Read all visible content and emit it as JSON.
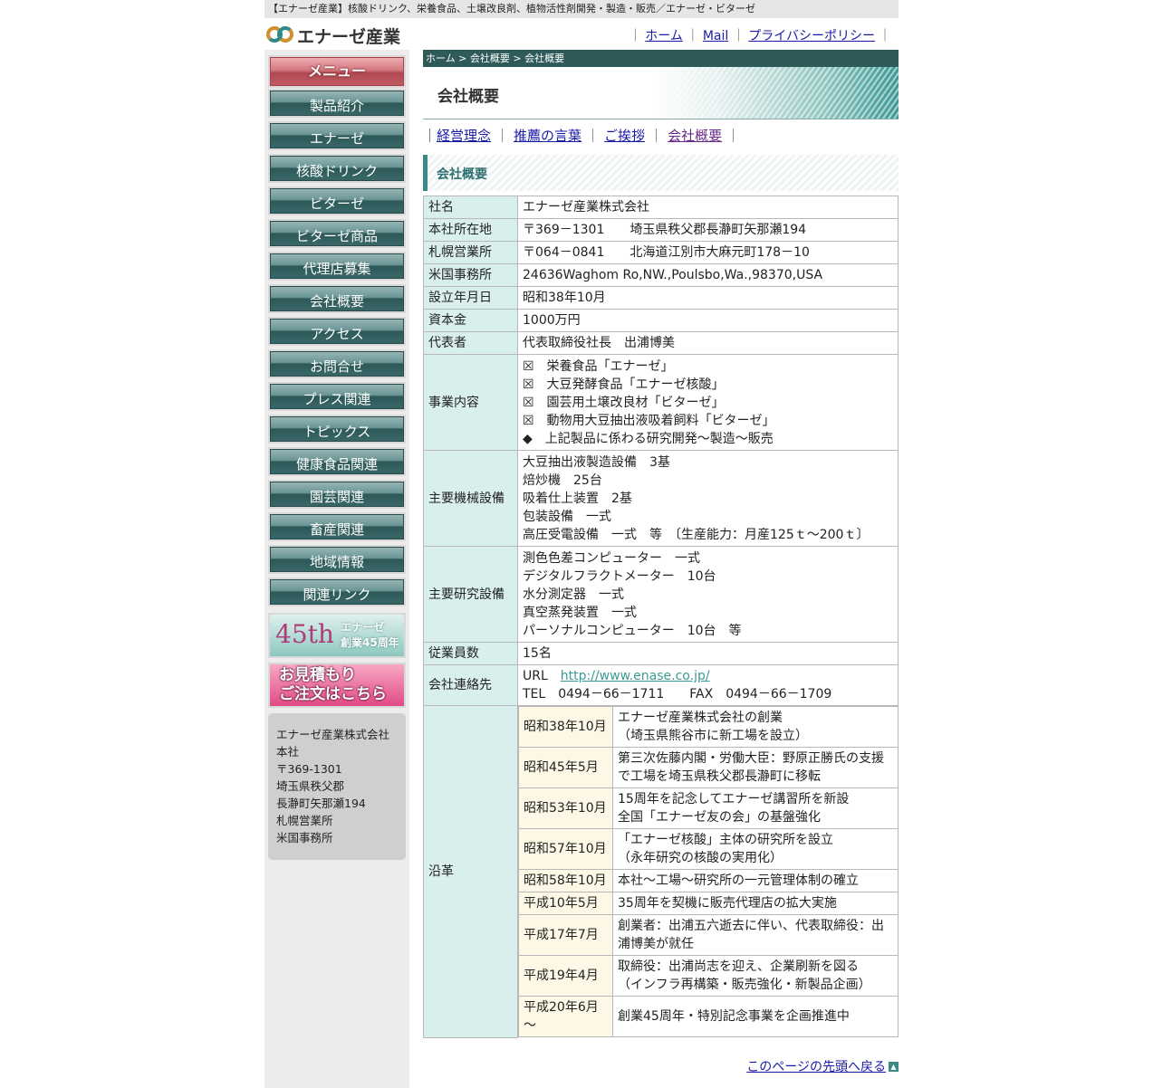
{
  "topbar": {
    "text": "【エナーゼ産業】核酸ドリンク、栄養食品、土壌改良剤、植物活性剤開発・製造・販売／エナーゼ・ビターゼ"
  },
  "header": {
    "logo_text": "エナーゼ産業",
    "nav": [
      {
        "label": "ホーム"
      },
      {
        "label": "Mail"
      },
      {
        "label": "プライバシーポリシー"
      }
    ],
    "separator": "｜"
  },
  "sidebar": {
    "menu_label": "メニュー",
    "items": [
      {
        "label": "製品紹介"
      },
      {
        "label": "エナーゼ"
      },
      {
        "label": "核酸ドリンク"
      },
      {
        "label": "ビターゼ"
      },
      {
        "label": "ビターゼ商品"
      },
      {
        "label": "代理店募集"
      },
      {
        "label": "会社概要"
      },
      {
        "label": "アクセス"
      },
      {
        "label": "お問合せ"
      },
      {
        "label": "プレス関連"
      },
      {
        "label": "トピックス"
      },
      {
        "label": "健康食品関連"
      },
      {
        "label": "園芸関連"
      },
      {
        "label": "畜産関連"
      },
      {
        "label": "地域情報"
      },
      {
        "label": "関連リンク"
      }
    ],
    "banner_45": {
      "big": "45th",
      "line1": "エナーゼ",
      "line2": "創業45周年"
    },
    "banner_order": {
      "line1": "お見積もり",
      "line2": "ご注文はこちら"
    },
    "address": [
      "エナーゼ産業株式会社",
      "本社",
      "〒369-1301",
      "埼玉県秩父郡",
      "長瀞町矢那瀬194",
      "札幌営業所",
      "米国事務所"
    ]
  },
  "main": {
    "breadcrumb": "ホーム > 会社概要 > 会社概要",
    "page_title": "会社概要",
    "subnav": [
      {
        "label": "経営理念"
      },
      {
        "label": "推薦の言葉"
      },
      {
        "label": "ご挨拶"
      },
      {
        "label": "会社概要"
      }
    ],
    "section_title": "会社概要",
    "rows": {
      "name": {
        "label": "社名",
        "value": "エナーゼ産業株式会社"
      },
      "hq": {
        "label": "本社所在地",
        "value": "〒369－1301　　埼玉県秩父郡長瀞町矢那瀬194"
      },
      "sapporo": {
        "label": "札幌営業所",
        "value": "〒064－0841　　北海道江別市大麻元町178－10"
      },
      "us": {
        "label": "米国事務所",
        "value": "24636Waghom Ro,NW.,Poulsbo,Wa.,98370,USA"
      },
      "founded": {
        "label": "設立年月日",
        "value": "昭和38年10月"
      },
      "capital": {
        "label": "資本金",
        "value": "1000万円"
      },
      "rep": {
        "label": "代表者",
        "value": "代表取締役社長　出浦博美"
      },
      "business": {
        "label": "事業内容",
        "lines": [
          "☒　栄養食品「エナーゼ」",
          "☒　大豆発酵食品「エナーゼ核酸」",
          "☒　園芸用土壌改良材「ビターゼ」",
          "☒　動物用大豆抽出液吸着飼料「ビターゼ」",
          "◆　上記製品に係わる研究開発～製造～販売"
        ]
      },
      "machines": {
        "label": "主要機械設備",
        "lines": [
          "大豆抽出液製造設備　3基",
          "焙炒機　25台",
          "吸着仕上装置　2基",
          "包装設備　一式",
          "高圧受電設備　一式　等　〔生産能力：月産125ｔ～200ｔ〕"
        ]
      },
      "research": {
        "label": "主要研究設備",
        "lines": [
          "測色色差コンピューター　一式",
          "デジタルフラクトメーター　10台",
          "水分測定器　一式",
          "真空蒸発装置　一式",
          "パーソナルコンピューター　10台　等"
        ]
      },
      "employees": {
        "label": "従業員数",
        "value": "15名"
      },
      "contact": {
        "label": "会社連絡先",
        "url_label": "URL　",
        "url": "http://www.enase.co.jp/",
        "tel": "TEL　0494－66－1711　　FAX　0494－66－1709"
      },
      "history": {
        "label": "沿革",
        "items": [
          {
            "date": "昭和38年10月",
            "lines": [
              "エナーゼ産業株式会社の創業",
              "（埼玉県熊谷市に新工場を設立）"
            ]
          },
          {
            "date": "昭和45年5月",
            "lines": [
              "第三次佐藤内閣・労働大臣：野原正勝氏の支援",
              "で工場を埼玉県秩父郡長瀞町に移転"
            ]
          },
          {
            "date": "昭和53年10月",
            "lines": [
              "15周年を記念してエナーゼ講習所を新設",
              "全国「エナーゼ友の会」の基盤強化"
            ]
          },
          {
            "date": "昭和57年10月",
            "lines": [
              "「エナーゼ核酸」主体の研究所を設立",
              "（永年研究の核酸の実用化）"
            ]
          },
          {
            "date": "昭和58年10月",
            "lines": [
              "本社～工場～研究所の一元管理体制の確立"
            ]
          },
          {
            "date": "平成10年5月",
            "lines": [
              "35周年を契機に販売代理店の拡大実施"
            ]
          },
          {
            "date": "平成17年7月",
            "lines": [
              "創業者：出浦五六逝去に伴い、代表取締役：出",
              "浦博美が就任"
            ]
          },
          {
            "date": "平成19年4月",
            "lines": [
              "取締役：出浦尚志を迎え、企業刷新を図る",
              "（インフラ再構築・販売強化・新製品企画）"
            ]
          },
          {
            "date": "平成20年6月～",
            "lines": [
              "創業45周年・特別記念事業を企画推進中"
            ]
          }
        ]
      }
    },
    "back_to_top": "このページの先頭へ戻る"
  },
  "colors": {
    "teal_dark": "#2e5a5a",
    "teal_accent": "#3a8a86",
    "label_bg": "#d8efee",
    "date_bg": "#fdf8e6",
    "link": "#1a1aa8"
  }
}
